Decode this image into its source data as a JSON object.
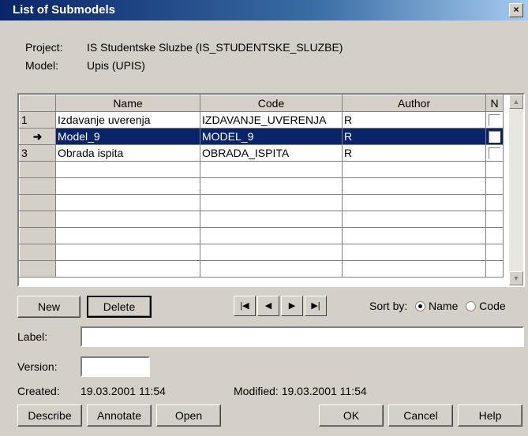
{
  "window": {
    "title": "List of Submodels",
    "close_glyph": "×"
  },
  "info": {
    "project_label": "Project:",
    "project_value": "IS Studentske Sluzbe  (IS_STUDENTSKE_SLUZBE)",
    "model_label": "Model:",
    "model_value": "Upis  (UPIS)"
  },
  "grid": {
    "columns": [
      "Name",
      "Code",
      "Author",
      "N"
    ],
    "rows": [
      {
        "indicator": "1",
        "name": "Izdavanje uverenja",
        "code": "IZDAVANJE_UVERENJA",
        "author": "R",
        "n": false,
        "selected": false
      },
      {
        "indicator": "➜",
        "name": "Model_9",
        "code": "MODEL_9",
        "author": "R",
        "n": false,
        "selected": true
      },
      {
        "indicator": "3",
        "name": "Obrada ispita",
        "code": "OBRADA_ISPITA",
        "author": "R",
        "n": false,
        "selected": false
      }
    ],
    "empty_rows": 7
  },
  "buttons": {
    "new": "New",
    "delete": "Delete",
    "describe": "Describe",
    "annotate": "Annotate",
    "open": "Open",
    "ok": "OK",
    "cancel": "Cancel",
    "help": "Help"
  },
  "nav": {
    "first": "|◀",
    "prev": "◀",
    "next": "▶",
    "last": "▶|"
  },
  "sort": {
    "label": "Sort by:",
    "options": [
      "Name",
      "Code"
    ],
    "selected": "Name"
  },
  "fields": {
    "label_label": "Label:",
    "label_value": "",
    "version_label": "Version:",
    "version_value": ""
  },
  "dates": {
    "created_label": "Created:",
    "created_value": "19.03.2001  11:54",
    "modified_label": "Modified:",
    "modified_value": "19.03.2001  11:54"
  },
  "icons": {
    "close": "close-icon",
    "row_pointer": "arrow-right-icon",
    "scroll_up": "scroll-up-icon",
    "scroll_down": "scroll-down-icon"
  }
}
